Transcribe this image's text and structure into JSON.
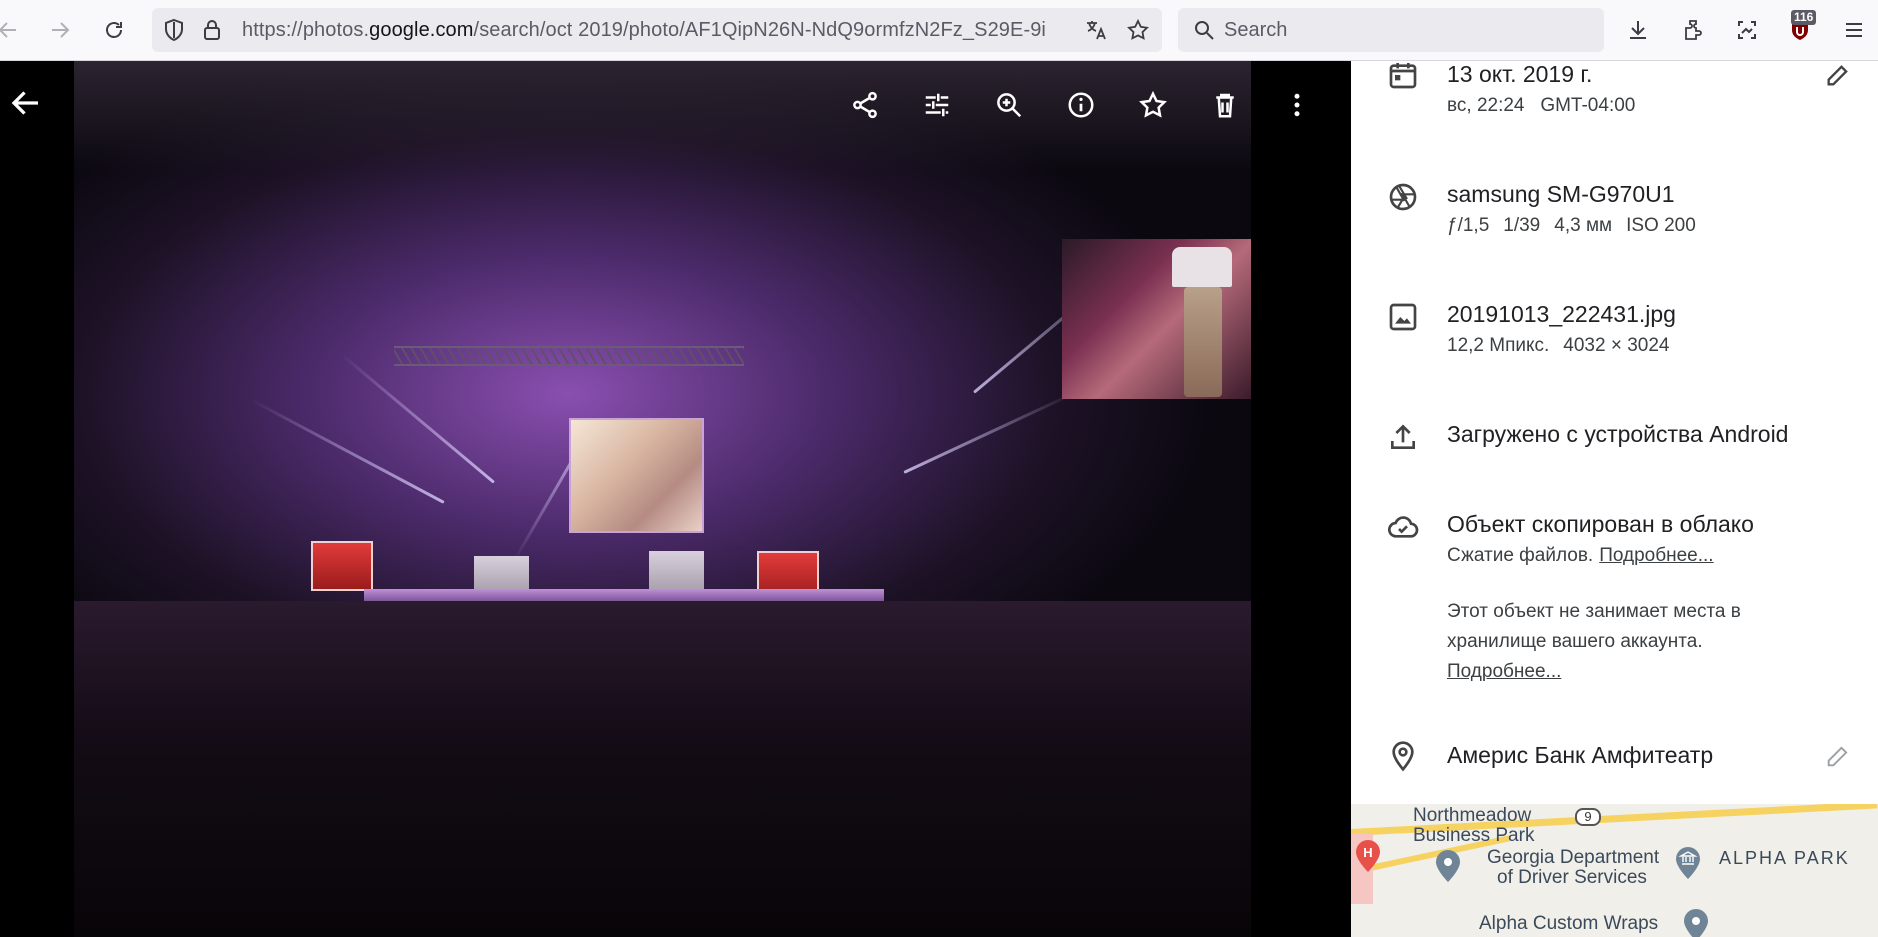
{
  "browser": {
    "url_prefix": "https://photos.",
    "url_domain": "google.com",
    "url_rest": "/search/oct 2019/photo/AF1QipN26N-NdQ9ormfzN2Fz_S29E-9i",
    "search_placeholder": "Search",
    "extension_badge": "116",
    "icons": [
      "back-arrow-icon",
      "forward-arrow-icon",
      "reload-icon",
      "shield-icon",
      "lock-icon",
      "translate-icon",
      "star-icon",
      "search-icon",
      "download-icon",
      "extensions-icon",
      "screenshot-icon",
      "ublock-icon",
      "hamburger-menu-icon"
    ]
  },
  "viewer": {
    "icons": [
      "back-arrow-icon",
      "share-icon",
      "edit-adjust-icon",
      "zoom-in-icon",
      "info-icon",
      "favorite-star-icon",
      "delete-icon",
      "more-vert-icon"
    ]
  },
  "info": {
    "date": "13 окт. 2019 г.",
    "time_line": "вс, 22:24   GMT-04:00",
    "camera": "samsung SM-G970U1",
    "aperture": "ƒ/1,5",
    "shutter": "1/39",
    "focal": "4,3 мм",
    "iso": "ISO 200",
    "filename": "20191013_222431.jpg",
    "megapixels": "12,2 Мпикс.",
    "resolution": "4032 × 3024",
    "uploaded": "Загружено с устройства Android",
    "backup_title": "Объект скопирован в облако",
    "backup_compression": "Сжатие файлов.",
    "backup_more_link": "Подробнее...",
    "storage_note": "Этот объект не занимает места в хранилище вашего аккаунта.",
    "storage_more_link": "Подробнее...",
    "location": "Америс Банк Амфитеатр"
  },
  "map": {
    "labels": {
      "northmeadow": "Northmeadow",
      "business_park": "Business Park",
      "route": "9",
      "georgia_1": "Georgia Department",
      "georgia_2": "of Driver Services",
      "alpha_park": "ALPHA PARK",
      "alpha_custom": "Alpha Custom Wraps",
      "hospital": "H"
    },
    "colors": {
      "road": "#f6d260",
      "land": "#f1efe9",
      "pin": "#6f8597",
      "hospital": "#e8504a"
    }
  }
}
